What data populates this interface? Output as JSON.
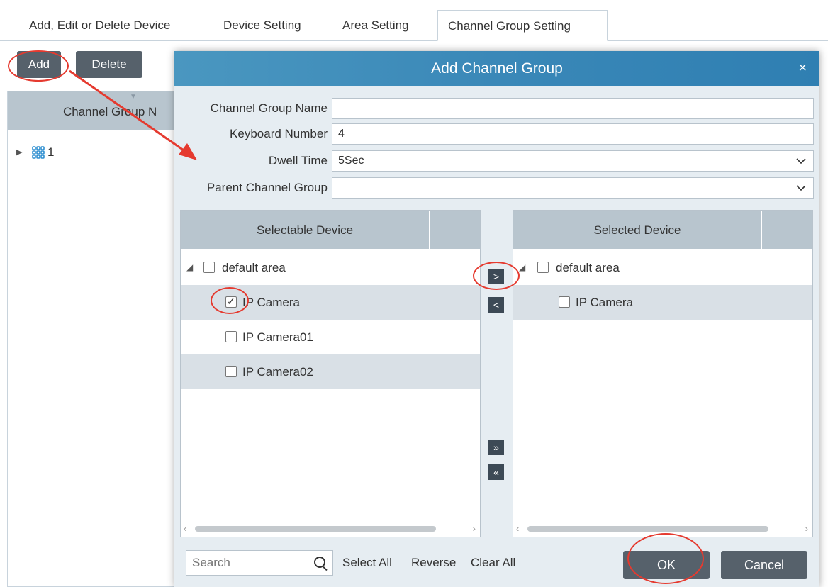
{
  "tabs": [
    {
      "label": "Add, Edit or Delete Device"
    },
    {
      "label": "Device Setting"
    },
    {
      "label": "Area Setting"
    },
    {
      "label": "Channel Group Setting"
    }
  ],
  "toolbar": {
    "add_label": "Add",
    "delete_label": "Delete"
  },
  "left_panel": {
    "header": "Channel Group N",
    "tree": [
      {
        "label": "1",
        "icon": "channel-group-grid-icon"
      }
    ]
  },
  "dialog": {
    "title": "Add Channel Group",
    "close_glyph": "×",
    "fields": {
      "channel_group_name": {
        "label": "Channel Group Name",
        "value": ""
      },
      "keyboard_number": {
        "label": "Keyboard Number",
        "value": "4"
      },
      "dwell_time": {
        "label": "Dwell Time",
        "value": "5Sec"
      },
      "parent_channel_group": {
        "label": "Parent Channel Group",
        "value": ""
      }
    },
    "selectable": {
      "header": "Selectable Device",
      "area": "default area",
      "devices": [
        {
          "label": "IP Camera",
          "checked": true
        },
        {
          "label": "IP Camera01",
          "checked": false
        },
        {
          "label": "IP Camera02",
          "checked": false
        }
      ]
    },
    "selected": {
      "header": "Selected Device",
      "area": "default area",
      "devices": [
        {
          "label": "IP Camera",
          "checked": false
        }
      ]
    },
    "move_buttons": {
      "add_one": ">",
      "remove_one": "<",
      "add_all": "»",
      "remove_all": "«"
    },
    "bottom": {
      "search_placeholder": "Search",
      "select_all": "Select All",
      "reverse": "Reverse",
      "clear_all": "Clear All",
      "ok": "OK",
      "cancel": "Cancel"
    }
  },
  "colors": {
    "title_bar": "#3a88b8",
    "dark_button": "#56616b",
    "panel_header": "#b8c5ce",
    "annotation": "#e53a2f",
    "grid_icon": "#2f8fd0"
  }
}
